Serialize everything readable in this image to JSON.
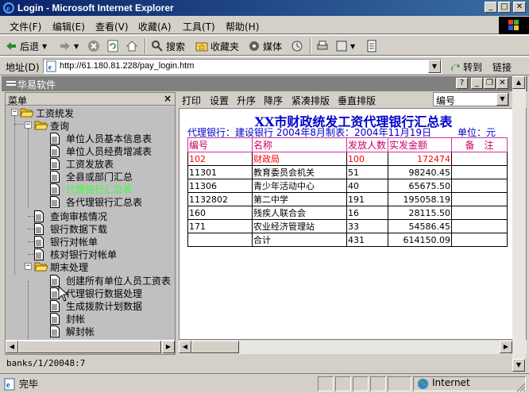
{
  "window": {
    "title": "Login - Microsoft Internet Explorer"
  },
  "menu": [
    "文件(F)",
    "编辑(E)",
    "查看(V)",
    "收藏(A)",
    "工具(T)",
    "帮助(H)"
  ],
  "toolbar": {
    "back": "后退",
    "search": "搜索",
    "favorites": "收藏夹",
    "media": "媒体"
  },
  "address": {
    "label": "地址(D)",
    "url": "http://61.180.81.228/pay_login.htm",
    "go": "转到",
    "links": "链接"
  },
  "inner": {
    "title": "华易软件",
    "status": "banks/1/20048:7"
  },
  "left_panel": {
    "header": "菜单",
    "tree": {
      "root": "工资统发",
      "query_group": "查询",
      "query_items": [
        "单位人员基本信息表",
        "单位人员经费增减表",
        "工资发放表",
        "全县或部门汇总",
        "代理银行汇总表",
        "各代理银行汇总表"
      ],
      "other_items": [
        "查询审核情况",
        "银行数据下载",
        "银行对帐单",
        "核对银行对帐单"
      ],
      "period_group": "期末处理",
      "period_items": [
        "创建所有单位人员工资表",
        "代理银行数据处理",
        "生成拨款计划数据",
        "封帐",
        "解封帐"
      ]
    }
  },
  "right_panel": {
    "tools": [
      "打印",
      "设置",
      "升序",
      "降序",
      "紧凑排版",
      "垂直排版"
    ],
    "sort_field": "编号",
    "report": {
      "title": "XX市财政统发工资代理银行汇总表",
      "meta": "代理银行：建设银行 2004年8月制表：2004年11月19日",
      "unit": "单位：元",
      "columns": [
        "编号",
        "名称",
        "发放人数",
        "实发金额",
        "备　注"
      ],
      "rows": [
        [
          "102",
          "财政局",
          "100",
          "172474",
          ""
        ],
        [
          "11301",
          "教育委员会机关",
          "51",
          "98240.45",
          ""
        ],
        [
          "11306",
          "青少年活动中心",
          "40",
          "65675.50",
          ""
        ],
        [
          "1132802",
          "第二中学",
          "191",
          "195058.19",
          ""
        ],
        [
          "160",
          "残疾人联合会",
          "16",
          "28115.50",
          ""
        ],
        [
          "171",
          "农业经济管理站",
          "33",
          "54586.45",
          ""
        ],
        [
          "",
          "合计",
          "431",
          "614150.09",
          ""
        ]
      ]
    }
  },
  "statusbar": {
    "done": "完毕",
    "zone": "Internet"
  }
}
